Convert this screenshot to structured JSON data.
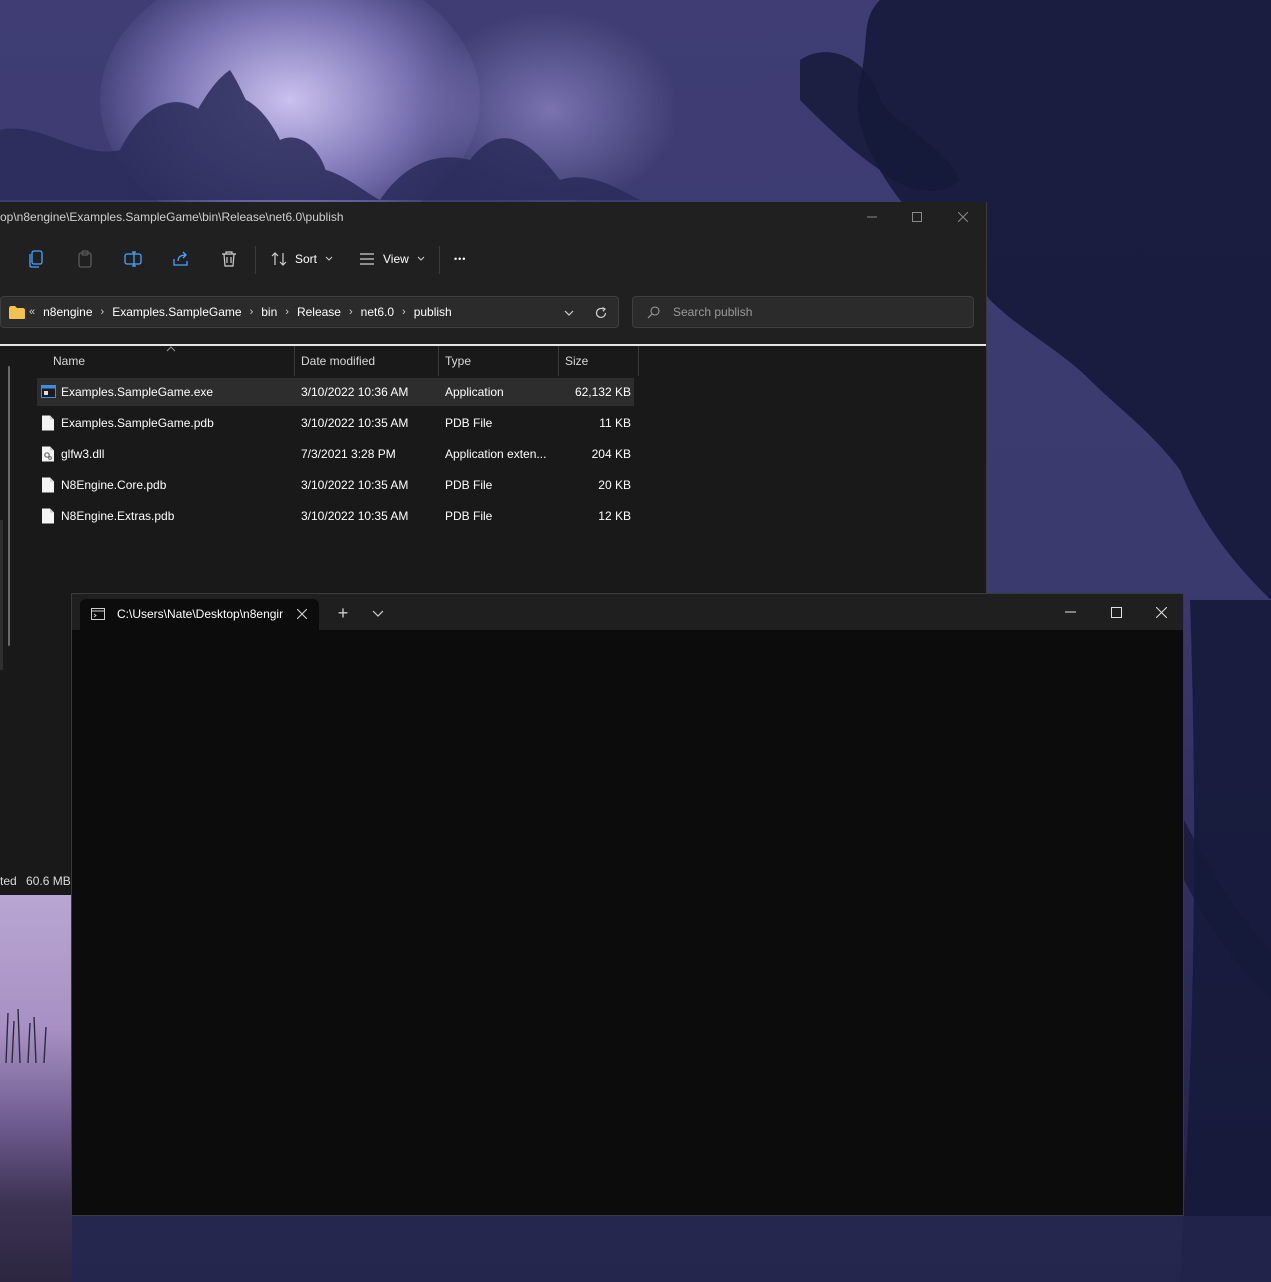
{
  "explorer": {
    "title": "op\\n8engine\\Examples.SampleGame\\bin\\Release\\net6.0\\publish",
    "toolbar": {
      "sort_label": "Sort",
      "view_label": "View",
      "more_label": "•••"
    },
    "breadcrumb": {
      "overflow": "«",
      "items": [
        "n8engine",
        "Examples.SampleGame",
        "bin",
        "Release",
        "net6.0",
        "publish"
      ]
    },
    "search": {
      "placeholder": "Search publish"
    },
    "columns": {
      "name": "Name",
      "date": "Date modified",
      "type": "Type",
      "size": "Size"
    },
    "files": [
      {
        "name": "Examples.SampleGame.exe",
        "date": "3/10/2022 10:36 AM",
        "type": "Application",
        "size": "62,132 KB",
        "icon": "exe-icon"
      },
      {
        "name": "Examples.SampleGame.pdb",
        "date": "3/10/2022 10:35 AM",
        "type": "PDB File",
        "size": "11 KB",
        "icon": "file-icon"
      },
      {
        "name": "glfw3.dll",
        "date": "7/3/2021 3:28 PM",
        "type": "Application exten...",
        "size": "204 KB",
        "icon": "dll-icon"
      },
      {
        "name": "N8Engine.Core.pdb",
        "date": "3/10/2022 10:35 AM",
        "type": "PDB File",
        "size": "20 KB",
        "icon": "file-icon"
      },
      {
        "name": "N8Engine.Extras.pdb",
        "date": "3/10/2022 10:35 AM",
        "type": "PDB File",
        "size": "12 KB",
        "icon": "file-icon"
      }
    ],
    "status": {
      "selected_fragment": "ted",
      "size": "60.6 MB"
    }
  },
  "terminal": {
    "tab_title": "C:\\Users\\Nate\\Desktop\\n8engir",
    "new_tab_label": "+"
  },
  "colors": {
    "accent_folder": "#f2c14e",
    "exe_icon_blue": "#3c8ee6",
    "explorer_bg": "#191919",
    "terminal_bg": "#0c0c0c"
  }
}
